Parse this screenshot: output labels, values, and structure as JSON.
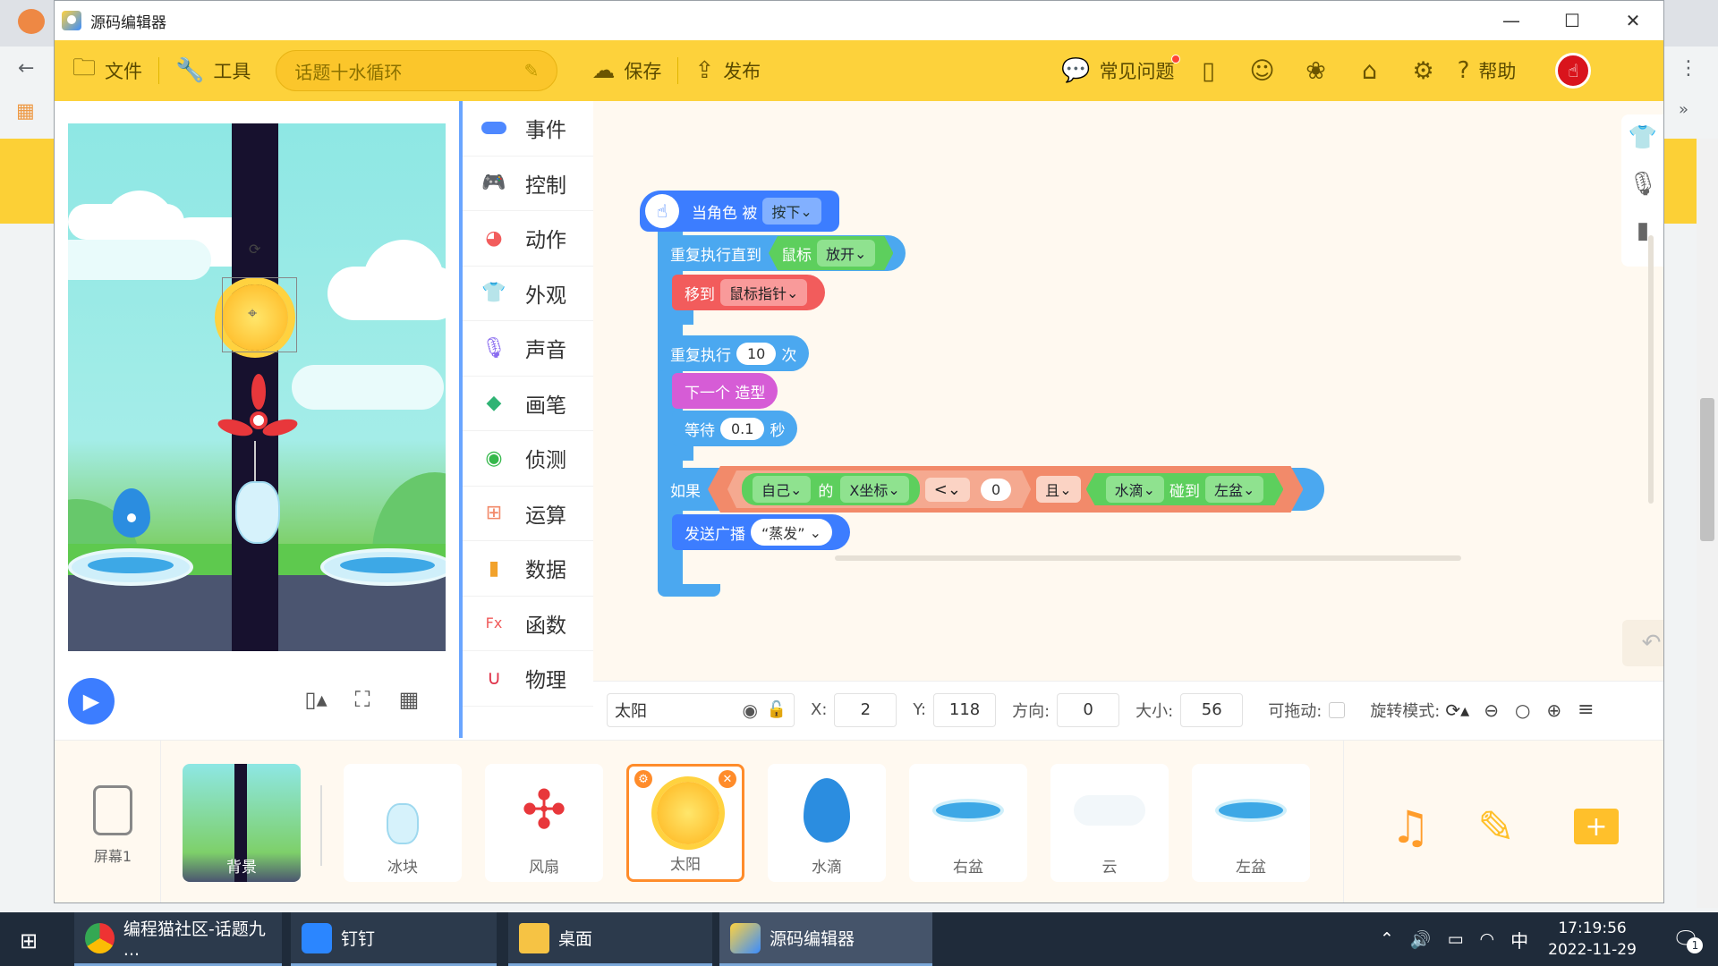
{
  "window": {
    "title": "源码编辑器"
  },
  "toolbar": {
    "file": "文件",
    "tools": "工具",
    "topic": "话题十水循环",
    "save": "保存",
    "publish": "发布",
    "faq": "常见问题",
    "help": "帮助"
  },
  "categories": [
    "事件",
    "控制",
    "动作",
    "外观",
    "声音",
    "画笔",
    "侦测",
    "运算",
    "数据",
    "函数",
    "物理"
  ],
  "category_colors": [
    "#4e88ff",
    "#3ca3ee",
    "#f25c5c",
    "#d65cd6",
    "#8a6cf0",
    "#2fb374",
    "#35b84b",
    "#f28a6a",
    "#f2a22b",
    "#f05a5a",
    "#e0334a"
  ],
  "blocks": {
    "when_pressed": "当角色 被",
    "pressed": "按下",
    "repeat_until": "重复执行直到",
    "mouse": "鼠标",
    "release": "放开",
    "move_to": "移到",
    "mouse_pointer": "鼠标指针",
    "repeat": "重复执行",
    "repeat_count": "10",
    "times": "次",
    "next_costume": "下一个 造型",
    "wait": "等待",
    "wait_value": "0.1",
    "seconds": "秒",
    "if": "如果",
    "self": "自己",
    "of": "的",
    "x_coord": "X坐标",
    "lt": "<",
    "zero": "0",
    "and": "且",
    "water_drop": "水滴",
    "touch": "碰到",
    "left_basin": "左盆",
    "broadcast": "发送广播",
    "evaporate": "“蒸发”"
  },
  "props": {
    "sprite_name": "太阳",
    "x_label": "X:",
    "x": "2",
    "y_label": "Y:",
    "y": "118",
    "dir_label": "方向:",
    "dir": "0",
    "size_label": "大小:",
    "size": "56",
    "drag_label": "可拖动:",
    "rot_label": "旋转模式:"
  },
  "sprites": {
    "screen": "屏幕1",
    "items": [
      "背景",
      "冰块",
      "风扇",
      "太阳",
      "水滴",
      "右盆",
      "云",
      "左盆"
    ]
  },
  "taskbar": {
    "chrome": "编程猫社区-话题九 ...",
    "dingtalk": "钉钉",
    "desktop": "桌面",
    "editor": "源码编辑器",
    "ime": "中",
    "time": "17:19:56",
    "date": "2022-11-29",
    "notify_count": "1"
  }
}
